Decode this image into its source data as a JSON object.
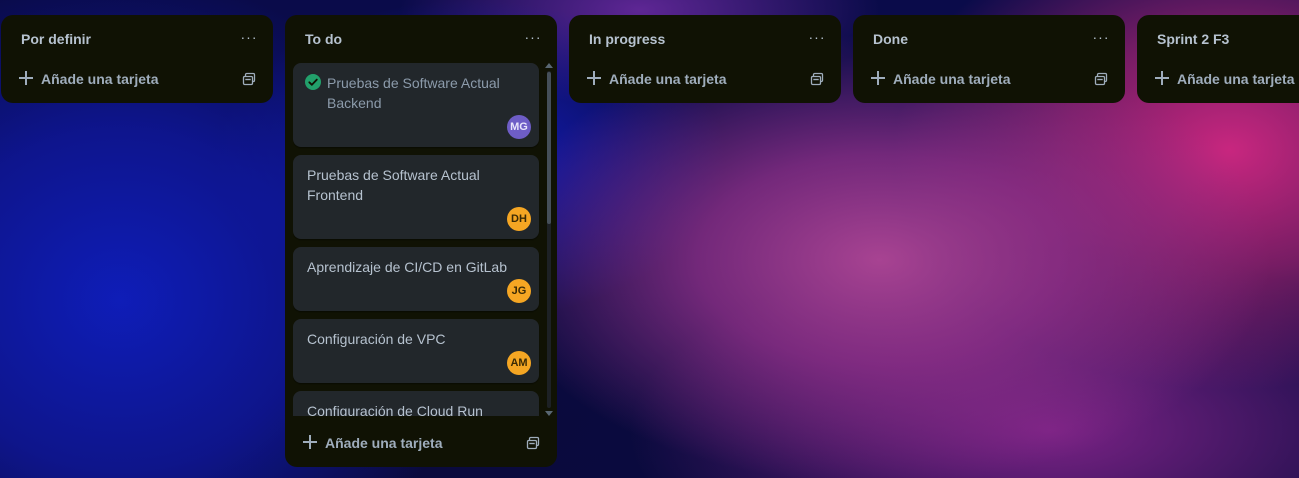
{
  "colors": {
    "list_bg": "#101204",
    "card_bg": "#22272b",
    "text": "#b6c2cf",
    "done_check": "#22a06b",
    "avatar_mg": "#6e5dc6",
    "avatar_orange": "#f5a623"
  },
  "lists": [
    {
      "title": "Por definir",
      "menu": "···",
      "add_label": "Añade una tarjeta"
    },
    {
      "title": "To do",
      "menu": "···",
      "add_label": "Añade una tarjeta",
      "cards": [
        {
          "title": "Pruebas de Software Actual Backend",
          "completed": true,
          "icon": "check-circle-icon",
          "member": "MG"
        },
        {
          "title": "Pruebas de Software Actual Frontend",
          "member": "DH"
        },
        {
          "title": "Aprendizaje de CI/CD en GitLab",
          "member": "JG"
        },
        {
          "title": "Configuración de VPC",
          "member": "AM"
        },
        {
          "title": "Configuración de Cloud Run"
        }
      ]
    },
    {
      "title": "In progress",
      "menu": "···",
      "add_label": "Añade una tarjeta"
    },
    {
      "title": "Done",
      "menu": "···",
      "add_label": "Añade una tarjeta"
    },
    {
      "title": "Sprint 2 F3",
      "menu": "···",
      "add_label": "Añade una tarjeta"
    }
  ]
}
